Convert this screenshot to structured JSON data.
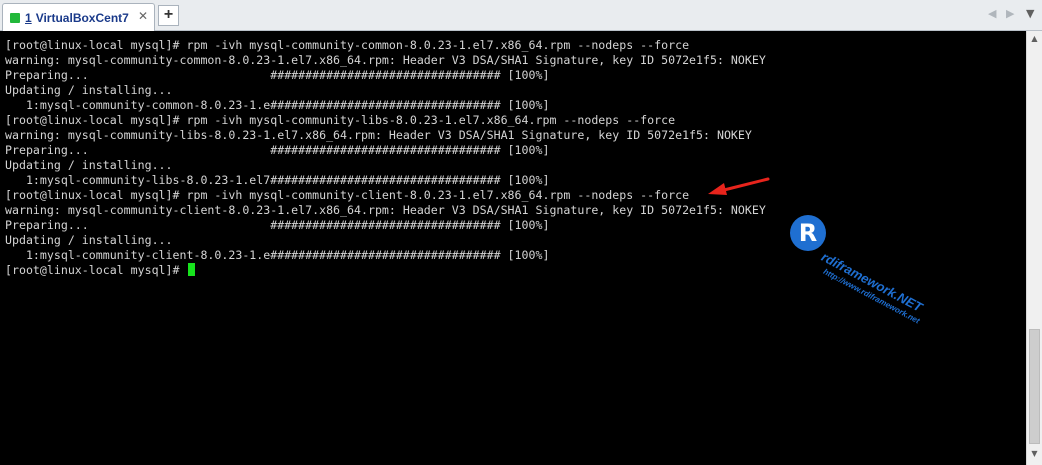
{
  "window": {
    "tab": {
      "number": "1",
      "title": "VirtualBoxCent7",
      "status_color": "#22b83a"
    },
    "add_tab_label": "+",
    "nav_prev_icon": "◀",
    "nav_next_icon": "▶",
    "menu_icon": "▼"
  },
  "terminal": {
    "lines": [
      "[root@linux-local mysql]# rpm -ivh mysql-community-common-8.0.23-1.el7.x86_64.rpm --nodeps --force",
      "warning: mysql-community-common-8.0.23-1.el7.x86_64.rpm: Header V3 DSA/SHA1 Signature, key ID 5072e1f5: NOKEY",
      "Preparing...                          ################################# [100%]",
      "Updating / installing...",
      "   1:mysql-community-common-8.0.23-1.e################################# [100%]",
      "[root@linux-local mysql]# rpm -ivh mysql-community-libs-8.0.23-1.el7.x86_64.rpm --nodeps --force",
      "warning: mysql-community-libs-8.0.23-1.el7.x86_64.rpm: Header V3 DSA/SHA1 Signature, key ID 5072e1f5: NOKEY",
      "Preparing...                          ################################# [100%]",
      "Updating / installing...",
      "   1:mysql-community-libs-8.0.23-1.el7################################# [100%]",
      "[root@linux-local mysql]# rpm -ivh mysql-community-client-8.0.23-1.el7.x86_64.rpm --nodeps --force",
      "warning: mysql-community-client-8.0.23-1.el7.x86_64.rpm: Header V3 DSA/SHA1 Signature, key ID 5072e1f5: NOKEY",
      "Preparing...                          ################################# [100%]",
      "Updating / installing...",
      "   1:mysql-community-client-8.0.23-1.e################################# [100%]"
    ],
    "prompt": "[root@linux-local mysql]# ",
    "cursor_color": "#17e31d"
  },
  "annotation": {
    "arrow_color": "#e8241c"
  },
  "watermark": {
    "logo_letter": "R",
    "text_main": "rdiframework.NET",
    "text_url": "http://www.rdiframework.net"
  },
  "scrollbar": {
    "up_icon": "▲",
    "down_icon": "▼"
  }
}
